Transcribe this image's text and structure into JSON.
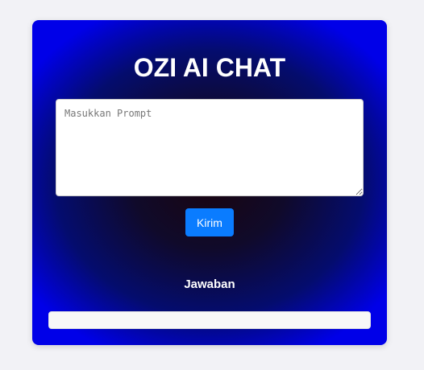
{
  "app": {
    "title": "OZI AI CHAT"
  },
  "prompt": {
    "placeholder": "Masukkan Prompt",
    "value": ""
  },
  "actions": {
    "send_label": "Kirim"
  },
  "answer": {
    "label": "Jawaban",
    "text": ""
  },
  "colors": {
    "page_background": "#f2f2f6",
    "card_edge": "#0000e8",
    "card_center": "#1a0510",
    "button": "#0a7cff",
    "title_text": "#ffffff"
  }
}
